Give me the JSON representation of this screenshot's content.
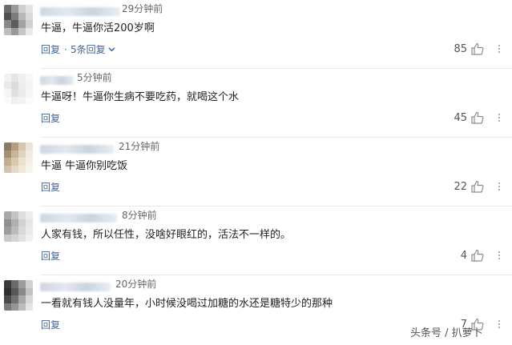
{
  "comments": [
    {
      "time": "29分钟前",
      "text": "牛逼，牛逼你活200岁啊",
      "reply": "回复",
      "replies": "5条回复",
      "likes": "85"
    },
    {
      "time": "5分钟前",
      "text": "牛逼呀！牛逼你生病不要吃药，就喝这个水",
      "reply": "回复",
      "likes": "45"
    },
    {
      "time": "21分钟前",
      "text": "牛逼 牛逼你别吃饭",
      "reply": "回复",
      "likes": "22"
    },
    {
      "time": "8分钟前",
      "text": "人家有钱，所以任性，没啥好眼红的，活法不一样的。",
      "reply": "回复",
      "likes": "4"
    },
    {
      "time": "20分钟前",
      "text": "一看就有钱人没量年，小时候没喝过加糖的水还是糖特少的那种",
      "reply": "回复",
      "likes": "7"
    }
  ],
  "separator": "·",
  "watermark": "头条号 / 扒萝卜",
  "icons": {
    "like": "thumbs-up-icon",
    "more": "more-vertical-icon",
    "expand": "chevron-down-icon"
  },
  "colors": {
    "link": "#406599",
    "muted": "#666666",
    "text": "#222222"
  }
}
